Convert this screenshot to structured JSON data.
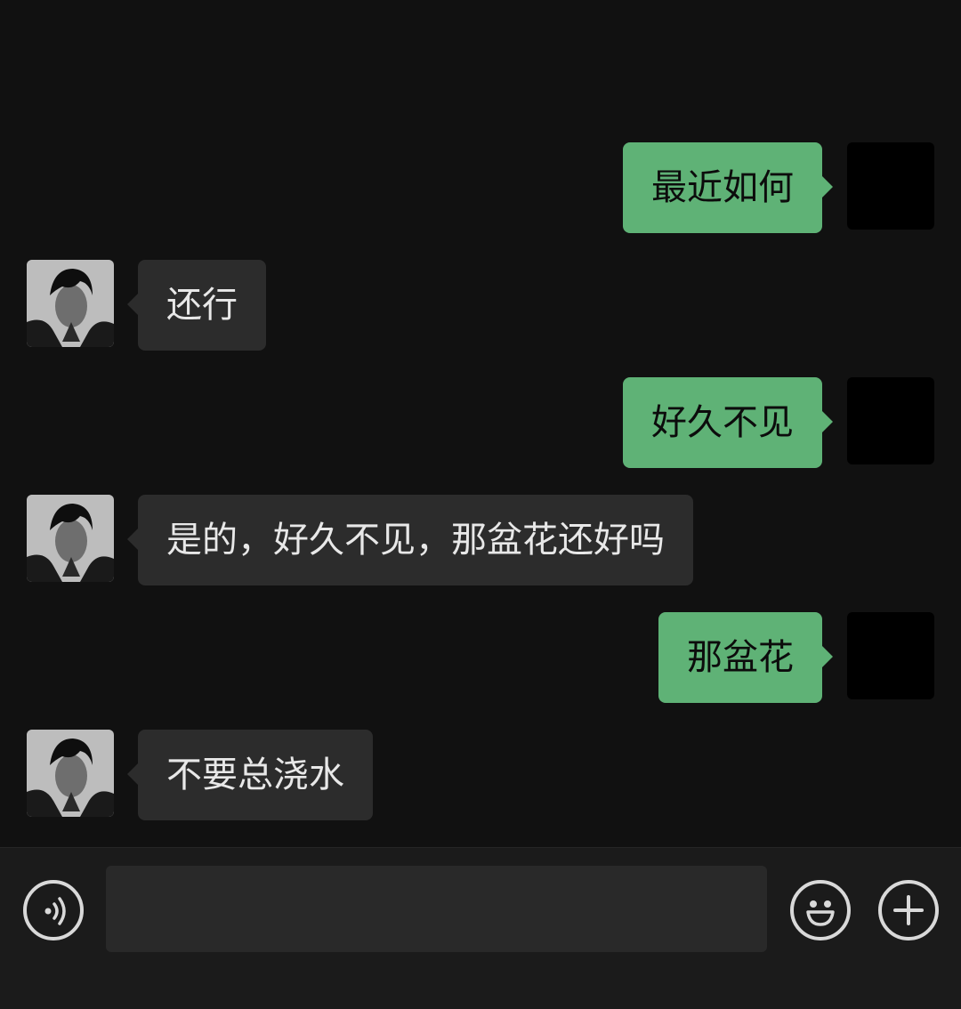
{
  "messages": [
    {
      "direction": "outgoing",
      "text": "最近如何"
    },
    {
      "direction": "incoming",
      "text": "还行"
    },
    {
      "direction": "outgoing",
      "text": "好久不见"
    },
    {
      "direction": "incoming",
      "text": "是的，好久不见，那盆花还好吗"
    },
    {
      "direction": "outgoing",
      "text": "那盆花"
    },
    {
      "direction": "incoming",
      "text": "不要总浇水"
    }
  ],
  "input_bar": {
    "message_value": "",
    "icons": {
      "voice": "voice-icon",
      "emoji": "emoji-icon",
      "more": "plus-icon"
    }
  },
  "colors": {
    "background": "#111111",
    "outgoing_bubble": "#5fb276",
    "incoming_bubble": "#2c2c2c",
    "input_bar": "#1b1b1b",
    "input_field": "#292929",
    "icon_stroke": "#d9d9d9"
  }
}
